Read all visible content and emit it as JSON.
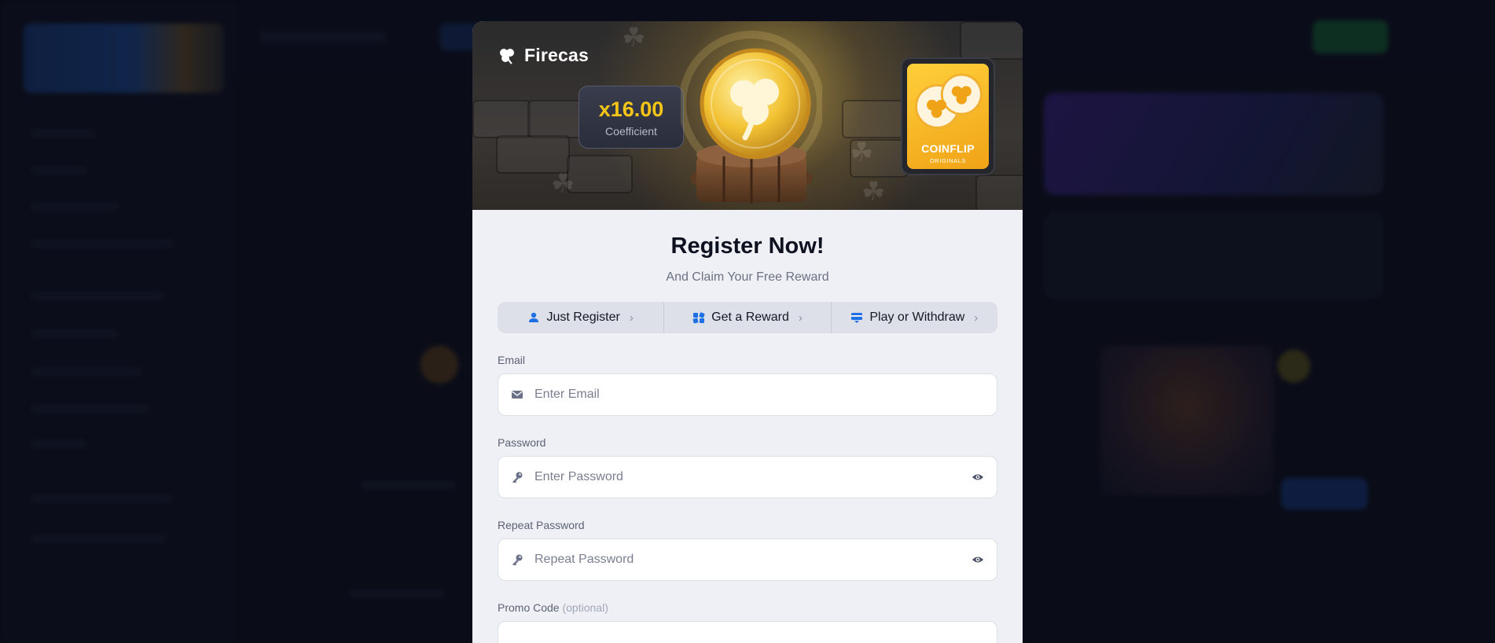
{
  "brand": {
    "name": "Firecas",
    "icon": "clover-icon"
  },
  "hero": {
    "coefficient_value": "x16.00",
    "coefficient_label": "Coefficient",
    "game_card": {
      "title": "COINFLIP",
      "subtitle": "ORIGINALS"
    }
  },
  "register": {
    "title": "Register Now!",
    "subtitle": "And Claim Your Free Reward",
    "steps": [
      {
        "label": "Just Register",
        "icon": "user-icon"
      },
      {
        "label": "Get a Reward",
        "icon": "gift-icon"
      },
      {
        "label": "Play or Withdraw",
        "icon": "wallet-icon"
      }
    ],
    "fields": {
      "email": {
        "label": "Email",
        "placeholder": "Enter Email",
        "value": ""
      },
      "password": {
        "label": "Password",
        "placeholder": "Enter Password",
        "value": ""
      },
      "repeat_password": {
        "label": "Repeat Password",
        "placeholder": "Repeat Password",
        "value": ""
      },
      "promo": {
        "label": "Promo Code",
        "optional": "(optional)",
        "placeholder": "",
        "value": ""
      }
    }
  },
  "colors": {
    "accent": "#f5c518",
    "primary_blue": "#1f6fe5",
    "modal_bg": "#eef0f5",
    "backdrop": "#0c0f1a"
  }
}
